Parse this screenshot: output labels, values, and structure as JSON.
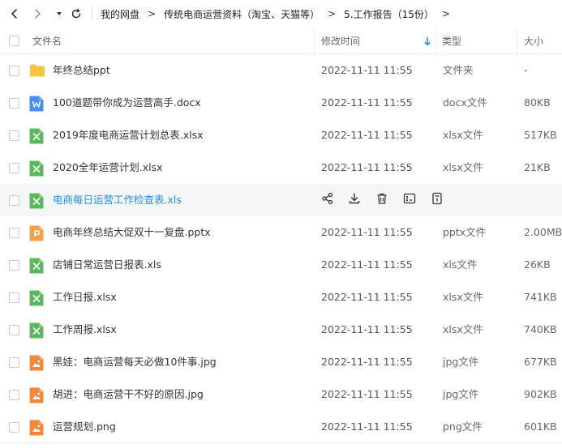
{
  "breadcrumb": {
    "items": [
      "我的网盘",
      "传统电商运营资料（淘宝、天猫等）",
      "5.工作报告（15份）"
    ],
    "separator": ">"
  },
  "header": {
    "name": "文件名",
    "modified": "修改时间",
    "type": "类型",
    "size": "大小"
  },
  "colors": {
    "accent": "#1e90d8",
    "folder": "#f7c544",
    "word": "#4a8ef0",
    "excel": "#5cb85c",
    "ppt": "#f5a04c",
    "image": "#f0883e"
  },
  "files": [
    {
      "name": "年终总结ppt",
      "date": "2022-11-11 11:55",
      "type": "文件夹",
      "size": "-",
      "icon": "folder-icon"
    },
    {
      "name": "100道题带你成为运营高手.docx",
      "date": "2022-11-11 11:55",
      "type": "docx文件",
      "size": "80KB",
      "icon": "word-file-icon"
    },
    {
      "name": "2019年度电商运营计划总表.xlsx",
      "date": "2022-11-11 11:55",
      "type": "xlsx文件",
      "size": "517KB",
      "icon": "excel-file-icon"
    },
    {
      "name": "2020全年运营计划.xlsx",
      "date": "2022-11-11 11:55",
      "type": "xlsx文件",
      "size": "21KB",
      "icon": "excel-file-icon"
    },
    {
      "name": "电商每日运营工作检查表.xls",
      "date": "",
      "type": "",
      "size": "",
      "icon": "excel-file-icon",
      "hover": true
    },
    {
      "name": "电商年终总结大促双十一复盘.pptx",
      "date": "2022-11-11 11:55",
      "type": "pptx文件",
      "size": "2.00MB",
      "icon": "ppt-file-icon"
    },
    {
      "name": "店铺日常运营日报表.xls",
      "date": "2022-11-11 11:55",
      "type": "xls文件",
      "size": "26KB",
      "icon": "excel-file-icon"
    },
    {
      "name": "工作日报.xlsx",
      "date": "2022-11-11 11:55",
      "type": "xlsx文件",
      "size": "741KB",
      "icon": "excel-file-icon"
    },
    {
      "name": "工作周报.xlsx",
      "date": "2022-11-11 11:55",
      "type": "xlsx文件",
      "size": "740KB",
      "icon": "excel-file-icon"
    },
    {
      "name": "黑娃：电商运营每天必做10件事.jpg",
      "date": "2022-11-11 11:55",
      "type": "jpg文件",
      "size": "677KB",
      "icon": "image-file-icon"
    },
    {
      "name": "胡进：电商运营干不好的原因.jpg",
      "date": "2022-11-11 11:55",
      "type": "jpg文件",
      "size": "902KB",
      "icon": "image-file-icon"
    },
    {
      "name": "运营规划.png",
      "date": "2022-11-11 11:55",
      "type": "png文件",
      "size": "601KB",
      "icon": "image-file-icon"
    }
  ],
  "row_actions": [
    "share-icon",
    "download-icon",
    "delete-icon",
    "rename-icon",
    "more-icon"
  ]
}
